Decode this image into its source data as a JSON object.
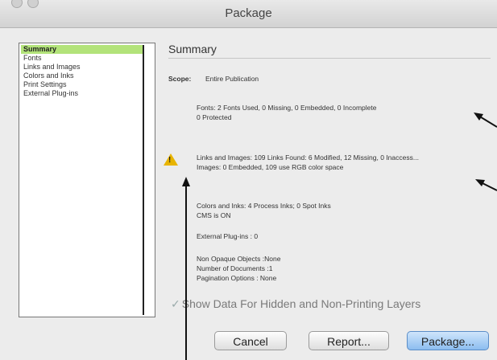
{
  "window": {
    "title": "Package"
  },
  "sidebar": {
    "items": [
      {
        "label": "Summary",
        "selected": true
      },
      {
        "label": "Fonts"
      },
      {
        "label": "Links and Images"
      },
      {
        "label": "Colors and Inks"
      },
      {
        "label": "Print Settings"
      },
      {
        "label": "External Plug-ins"
      }
    ]
  },
  "main": {
    "heading": "Summary",
    "scope_label": "Scope:",
    "scope_value": "Entire Publication",
    "fonts_line1": "Fonts: 2 Fonts Used, 0 Missing, 0 Embedded, 0 Incomplete",
    "fonts_line2": "0 Protected",
    "links_line1": "Links and Images: 109 Links Found: 6 Modified, 12 Missing, 0 Inaccess...",
    "links_line2": "Images: 0 Embedded, 109 use RGB color space",
    "colors_line1": "Colors and Inks: 4 Process Inks; 0 Spot Inks",
    "colors_line2": "CMS is ON",
    "plugins_line": "External Plug-ins : 0",
    "nonopaque_line": "Non Opaque Objects :None",
    "documents_line": "Number of Documents :1",
    "pagination_line": "Pagination Options : None",
    "checkbox_label": "Show Data For Hidden and Non-Printing Layers"
  },
  "buttons": {
    "cancel": "Cancel",
    "report": "Report...",
    "package": "Package..."
  },
  "colors": {
    "selected_item": "#b3e37a",
    "warning": "#e8b400",
    "primary_button": "#8cbdf0"
  }
}
